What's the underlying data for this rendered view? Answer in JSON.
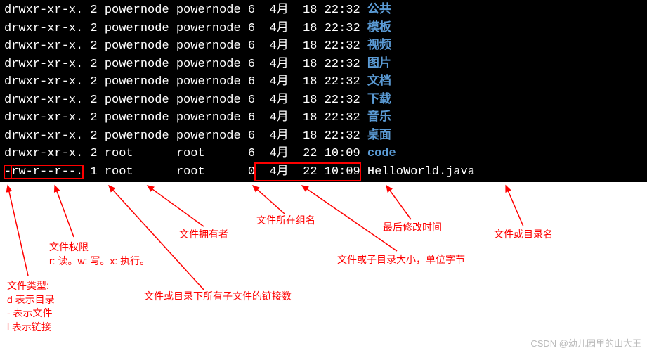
{
  "terminal": {
    "rows": [
      {
        "perm": "drwxr-xr-x.",
        "links": "2",
        "owner": "powernode",
        "group": "powernode",
        "size": "6",
        "month": "4月",
        "day": "18",
        "time": "22:32",
        "name": "公共",
        "dir": true
      },
      {
        "perm": "drwxr-xr-x.",
        "links": "2",
        "owner": "powernode",
        "group": "powernode",
        "size": "6",
        "month": "4月",
        "day": "18",
        "time": "22:32",
        "name": "模板",
        "dir": true
      },
      {
        "perm": "drwxr-xr-x.",
        "links": "2",
        "owner": "powernode",
        "group": "powernode",
        "size": "6",
        "month": "4月",
        "day": "18",
        "time": "22:32",
        "name": "视频",
        "dir": true
      },
      {
        "perm": "drwxr-xr-x.",
        "links": "2",
        "owner": "powernode",
        "group": "powernode",
        "size": "6",
        "month": "4月",
        "day": "18",
        "time": "22:32",
        "name": "图片",
        "dir": true
      },
      {
        "perm": "drwxr-xr-x.",
        "links": "2",
        "owner": "powernode",
        "group": "powernode",
        "size": "6",
        "month": "4月",
        "day": "18",
        "time": "22:32",
        "name": "文档",
        "dir": true
      },
      {
        "perm": "drwxr-xr-x.",
        "links": "2",
        "owner": "powernode",
        "group": "powernode",
        "size": "6",
        "month": "4月",
        "day": "18",
        "time": "22:32",
        "name": "下载",
        "dir": true
      },
      {
        "perm": "drwxr-xr-x.",
        "links": "2",
        "owner": "powernode",
        "group": "powernode",
        "size": "6",
        "month": "4月",
        "day": "18",
        "time": "22:32",
        "name": "音乐",
        "dir": true
      },
      {
        "perm": "drwxr-xr-x.",
        "links": "2",
        "owner": "powernode",
        "group": "powernode",
        "size": "6",
        "month": "4月",
        "day": "18",
        "time": "22:32",
        "name": "桌面",
        "dir": true
      },
      {
        "perm": "drwxr-xr-x.",
        "links": "2",
        "owner": "root",
        "group": "root",
        "size": "6",
        "month": "4月",
        "day": "22",
        "time": "10:09",
        "name": "code",
        "dir": true
      },
      {
        "perm": "-rw-r--r--.",
        "links": "1",
        "owner": "root",
        "group": "root",
        "size": "0",
        "month": "4月",
        "day": "22",
        "time": "10:09",
        "name": "HelloWorld.java",
        "dir": false,
        "highlight": true
      }
    ]
  },
  "annotations": {
    "filetype_title": "文件类型:",
    "filetype_lines": [
      "d 表示目录",
      "- 表示文件",
      "l 表示链接"
    ],
    "perm_title": "文件权限",
    "perm_desc": "r: 读。w: 写。x: 执行。",
    "links": "文件或目录下所有子文件的链接数",
    "owner": "文件拥有者",
    "group": "文件所在组名",
    "size": "文件或子目录大小，单位字节",
    "mtime": "最后修改时间",
    "name": "文件或目录名"
  },
  "watermark": "CSDN @幼儿园里的山大王"
}
